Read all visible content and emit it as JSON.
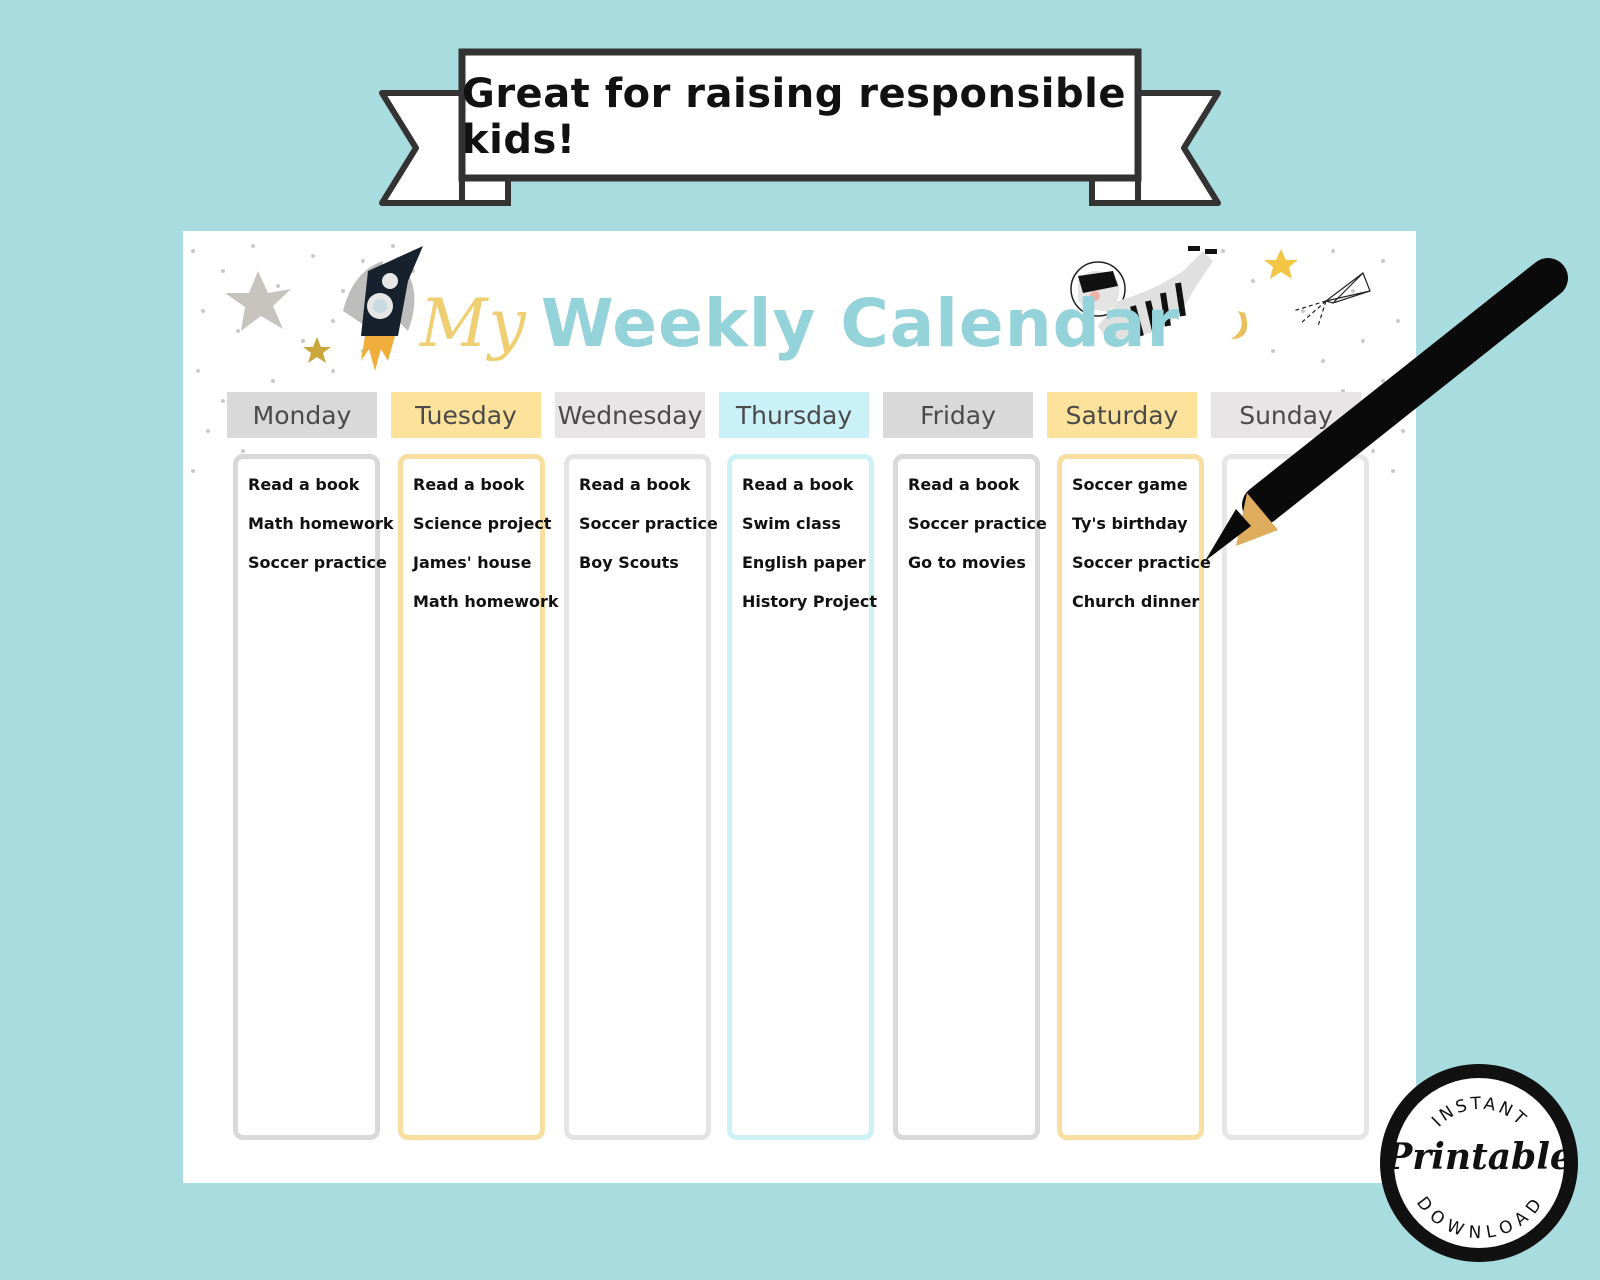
{
  "banner": {
    "text": "Great for raising responsible kids!"
  },
  "calendar": {
    "title_prefix": "My",
    "title_main": "Weekly Calendar",
    "days": [
      {
        "name": "Monday",
        "header_color": "#d9d9d9",
        "border_color": "#d9d9d9",
        "tasks": [
          "Read a book",
          "Math homework",
          "Soccer practice"
        ]
      },
      {
        "name": "Tuesday",
        "header_color": "#fde29b",
        "border_color": "#f8dea0",
        "tasks": [
          "Read a book",
          "Science project",
          "James' house",
          "Math homework"
        ]
      },
      {
        "name": "Wednesday",
        "header_color": "#e7e5e6",
        "border_color": "#e4e4e4",
        "tasks": [
          "Read a book",
          "Soccer practice",
          "Boy Scouts"
        ]
      },
      {
        "name": "Thursday",
        "header_color": "#c9f1f7",
        "border_color": "#cdf2f5",
        "tasks": [
          "Read a book",
          "Swim class",
          "English paper",
          "History Project"
        ]
      },
      {
        "name": "Friday",
        "header_color": "#d9d9d9",
        "border_color": "#d9d9d9",
        "tasks": [
          "Read a book",
          "Soccer practice",
          "Go to movies"
        ]
      },
      {
        "name": "Saturday",
        "header_color": "#fde29b",
        "border_color": "#f8dea0",
        "tasks": [
          "Soccer game",
          "Ty's birthday",
          "Soccer practice",
          "Church dinner"
        ]
      },
      {
        "name": "Sunday",
        "header_color": "#e7e5e6",
        "border_color": "#e6e6e6",
        "tasks": []
      }
    ]
  },
  "badge": {
    "top": "INSTANT",
    "main": "Printable",
    "bottom": "DOWNLOAD"
  },
  "illustrations": {
    "left": [
      "star-icon",
      "rocket-icon",
      "small-star-icon"
    ],
    "right": [
      "zebra-astronaut-icon",
      "star-icon",
      "moon-icon",
      "kite-icon"
    ],
    "overlay": "pencil-icon"
  },
  "colors": {
    "background": "#a9dcdf",
    "title": "#95d3da",
    "title_prefix": "#f0cf72"
  }
}
